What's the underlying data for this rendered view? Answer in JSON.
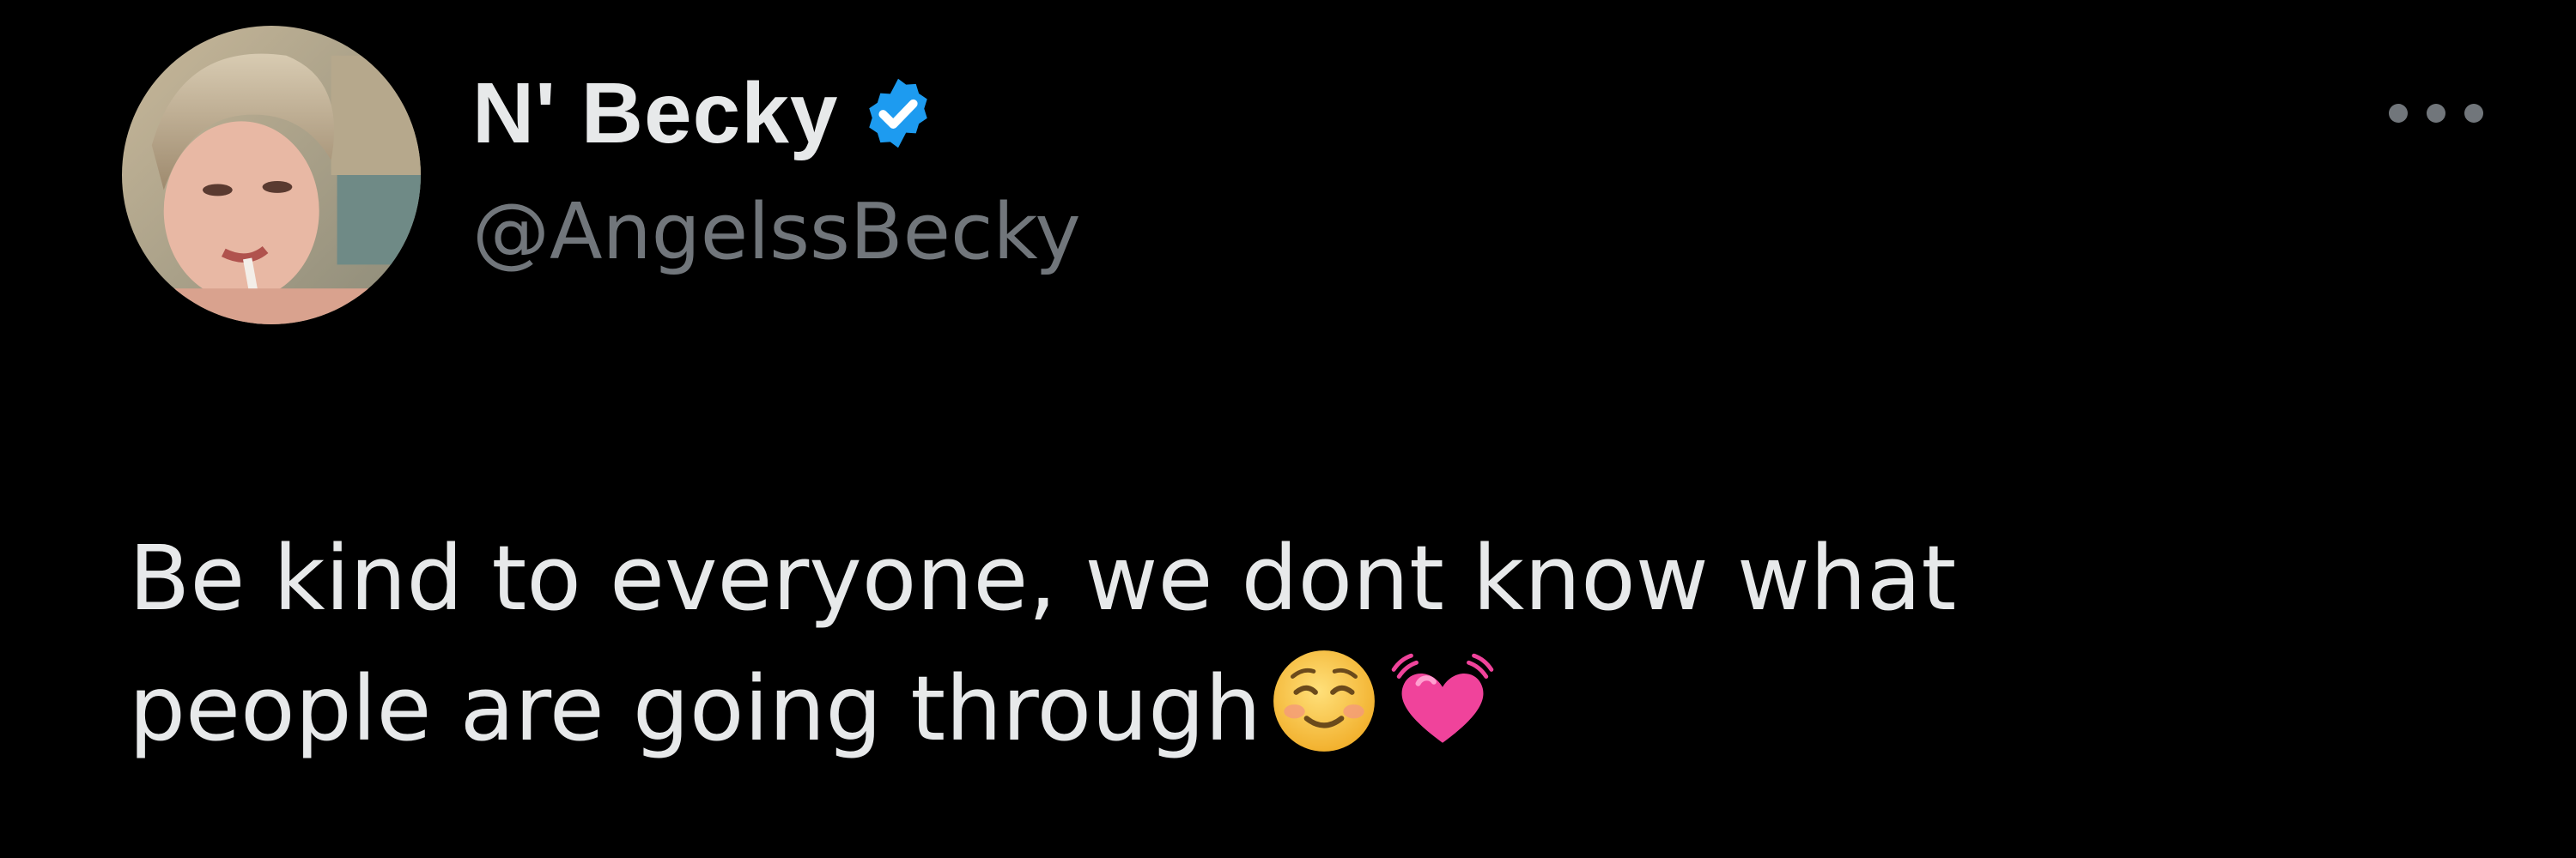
{
  "author": {
    "display_name": "N' Becky",
    "handle": "@AngelssBecky",
    "verified": true,
    "avatar_icon": "profile-photo"
  },
  "header": {
    "more_icon": "more-options-icon"
  },
  "tweet": {
    "text_line_1": "Be kind to everyone, we dont know what",
    "text_line_2": "people are going through",
    "emojis": [
      "smiling-face-icon",
      "beating-heart-icon"
    ]
  },
  "colors": {
    "background": "#000000",
    "text_primary": "#e7e9ea",
    "text_secondary": "#71767b",
    "verified_blue": "#1d9bf0",
    "heart_pink": "#f0439b",
    "emoji_yellow": "#f6c23a"
  }
}
